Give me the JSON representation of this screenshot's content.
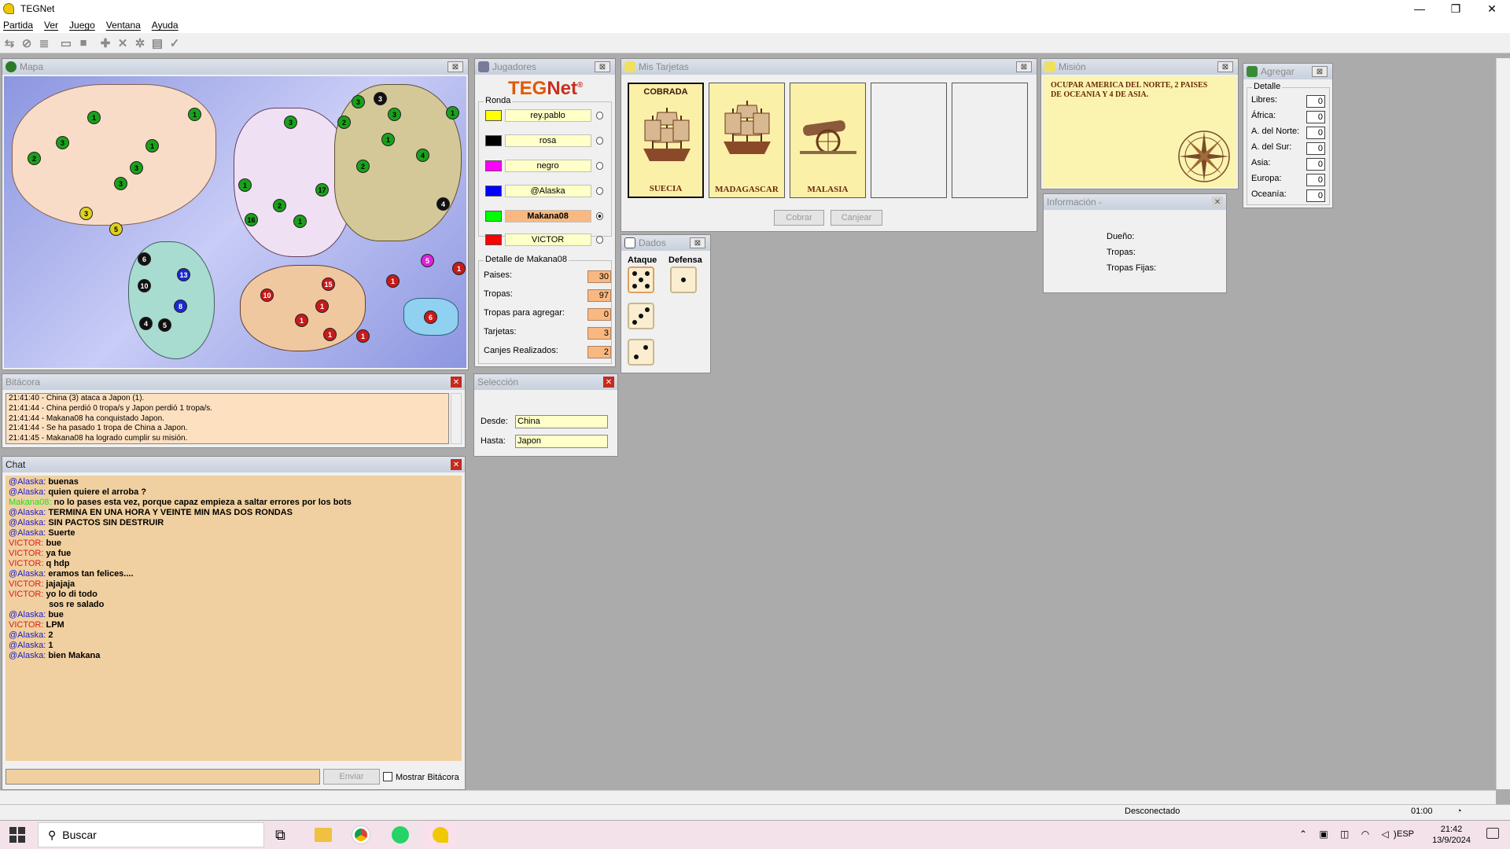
{
  "window": {
    "title": "TEGNet",
    "minimize": "—",
    "maximize": "❐",
    "close": "✕"
  },
  "menu": [
    "Partida",
    "Ver",
    "Juego",
    "Ventana",
    "Ayuda"
  ],
  "map": {
    "title": "Mapa",
    "armies": [
      {
        "n": "1",
        "c": "#1aa01a"
      },
      {
        "n": "3",
        "c": "#1aa01a"
      },
      {
        "n": "2",
        "c": "#1aa01a"
      },
      {
        "n": "1",
        "c": "#1aa01a"
      },
      {
        "n": "3",
        "c": "#1aa01a"
      },
      {
        "n": "3",
        "c": "#1aa01a"
      },
      {
        "n": "3",
        "c": "#e0d020"
      },
      {
        "n": "5",
        "c": "#e0d020"
      },
      {
        "n": "1",
        "c": "#1aa01a"
      },
      {
        "n": "6",
        "c": "#111111"
      },
      {
        "n": "10",
        "c": "#111111"
      },
      {
        "n": "13",
        "c": "#1a2ad0"
      },
      {
        "n": "8",
        "c": "#1a2ad0"
      },
      {
        "n": "4",
        "c": "#111111"
      },
      {
        "n": "5",
        "c": "#111111"
      },
      {
        "n": "3",
        "c": "#1aa01a"
      },
      {
        "n": "3",
        "c": "#111111"
      },
      {
        "n": "3",
        "c": "#1aa01a"
      },
      {
        "n": "2",
        "c": "#1aa01a"
      },
      {
        "n": "1",
        "c": "#1aa01a"
      },
      {
        "n": "3",
        "c": "#1aa01a"
      },
      {
        "n": "2",
        "c": "#1aa01a"
      },
      {
        "n": "4",
        "c": "#1aa01a"
      },
      {
        "n": "1",
        "c": "#1aa01a"
      },
      {
        "n": "4",
        "c": "#111111"
      },
      {
        "n": "1",
        "c": "#1aa01a"
      },
      {
        "n": "10",
        "c": "#c81a1a"
      },
      {
        "n": "15",
        "c": "#c81a1a"
      },
      {
        "n": "1",
        "c": "#c81a1a"
      },
      {
        "n": "1",
        "c": "#c81a1a"
      },
      {
        "n": "1",
        "c": "#c81a1a"
      },
      {
        "n": "1",
        "c": "#c81a1a"
      },
      {
        "n": "1",
        "c": "#c81a1a"
      },
      {
        "n": "5",
        "c": "#e020e0"
      },
      {
        "n": "1",
        "c": "#c81a1a"
      },
      {
        "n": "6",
        "c": "#c81a1a"
      },
      {
        "n": "16",
        "c": "#1aa01a"
      },
      {
        "n": "1",
        "c": "#1aa01a"
      },
      {
        "n": "17",
        "c": "#1aa01a"
      },
      {
        "n": "2",
        "c": "#1aa01a"
      }
    ]
  },
  "jugadores": {
    "title": "Jugadores",
    "logo_teg": "TEG",
    "logo_net": "Net",
    "logo_reg": "®",
    "ronda_label": "Ronda",
    "players": [
      {
        "name": "rey.pablo",
        "color": "#ffff00"
      },
      {
        "name": "rosa",
        "color": "#000000"
      },
      {
        "name": "negro",
        "color": "#ff00ff"
      },
      {
        "name": "@Alaska",
        "color": "#0000ff"
      },
      {
        "name": "Makana08",
        "color": "#00ff00"
      },
      {
        "name": "VICTOR",
        "color": "#ff0000"
      }
    ],
    "detail_label": "Detalle de Makana08",
    "details": [
      {
        "label": "Paises:",
        "value": "30"
      },
      {
        "label": "Tropas:",
        "value": "97"
      },
      {
        "label": "Tropas para agregar:",
        "value": "0"
      },
      {
        "label": "Tarjetas:",
        "value": "3"
      },
      {
        "label": "Canjes Realizados:",
        "value": "2"
      }
    ]
  },
  "tarjetas": {
    "title": "Mis Tarjetas",
    "cards": [
      {
        "name": "SUECIA",
        "top": "COBRADA"
      },
      {
        "name": "MADAGASCAR",
        "top": ""
      },
      {
        "name": "MALASIA",
        "top": ""
      }
    ],
    "cobrar": "Cobrar",
    "canjear": "Canjear"
  },
  "mision": {
    "title": "Misión",
    "text": "OCUPAR AMERICA DEL NORTE, 2 PAISES DE OCEANIA Y 4 DE ASIA."
  },
  "agregar": {
    "title": "Agregar",
    "detail_label": "Detalle",
    "rows": [
      {
        "label": "Libres:",
        "value": "0"
      },
      {
        "label": "África:",
        "value": "0"
      },
      {
        "label": "A. del Norte:",
        "value": "0"
      },
      {
        "label": "A. del Sur:",
        "value": "0"
      },
      {
        "label": "Asia:",
        "value": "0"
      },
      {
        "label": "Europa:",
        "value": "0"
      },
      {
        "label": "Oceanía:",
        "value": "0"
      }
    ]
  },
  "informacion": {
    "title": "Información -",
    "dueno": "Dueño:",
    "tropas": "Tropas:",
    "fijas": "Tropas Fijas:"
  },
  "dados": {
    "title": "Dados",
    "ataque": "Ataque",
    "defensa": "Defensa"
  },
  "bitacora": {
    "title": "Bitácora",
    "lines": [
      "21:41:40 - China (3) ataca a Japon (1).",
      "21:41:44 - China perdió 0 tropa/s y Japon perdió 1 tropa/s.",
      "21:41:44 - Makana08 ha conquistado Japon.",
      "21:41:44 - Se ha pasado 1 tropa de China a Japon.",
      "21:41:45 - Makana08 ha logrado cumplir su misión."
    ]
  },
  "seleccion": {
    "title": "Selección",
    "desde_label": "Desde:",
    "desde": "China",
    "hasta_label": "Hasta:",
    "hasta": "Japon"
  },
  "chat": {
    "title": "Chat",
    "messages": [
      {
        "who": "@Alaska:",
        "msg": "buenas",
        "color": "#1a1ad0"
      },
      {
        "who": "@Alaska:",
        "msg": "quien quiere el arroba ?",
        "color": "#1a1ad0"
      },
      {
        "who": "Makana08:",
        "msg": "no lo pases esta vez, porque capaz empieza a saltar errores por los bots",
        "color": "#20e020"
      },
      {
        "who": "@Alaska:",
        "msg": "TERMINA EN UNA HORA Y VEINTE MIN MAS DOS RONDAS",
        "color": "#1a1ad0"
      },
      {
        "who": "@Alaska:",
        "msg": "SIN PACTOS SIN DESTRUIR",
        "color": "#1a1ad0"
      },
      {
        "who": "@Alaska:",
        "msg": "Suerte",
        "color": "#1a1ad0"
      },
      {
        "who": "VICTOR:",
        "msg": "bue",
        "color": "#e01a1a"
      },
      {
        "who": "VICTOR:",
        "msg": "ya fue",
        "color": "#e01a1a"
      },
      {
        "who": "VICTOR:",
        "msg": "q hdp",
        "color": "#e01a1a"
      },
      {
        "who": "@Alaska:",
        "msg": "eramos tan felices....",
        "color": "#1a1ad0"
      },
      {
        "who": "VICTOR:",
        "msg": "jajajaja",
        "color": "#e01a1a"
      },
      {
        "who": "VICTOR:",
        "msg": "yo lo di todo",
        "color": "#e01a1a"
      },
      {
        "who": "",
        "msg": "sos re salado",
        "color": "#e0e020"
      },
      {
        "who": "@Alaska:",
        "msg": "bue",
        "color": "#1a1ad0"
      },
      {
        "who": "VICTOR:",
        "msg": "LPM",
        "color": "#e01a1a"
      },
      {
        "who": "@Alaska:",
        "msg": "2",
        "color": "#1a1ad0"
      },
      {
        "who": "@Alaska:",
        "msg": "1",
        "color": "#1a1ad0"
      },
      {
        "who": "@Alaska:",
        "msg": "bien Makana",
        "color": "#1a1ad0"
      }
    ],
    "send": "Enviar",
    "show_log": "Mostrar Bitácora"
  },
  "statusbar": {
    "state": "Desconectado",
    "time": "01:00"
  },
  "taskbar": {
    "search": "Buscar",
    "lang": "ESP",
    "clock": "21:42",
    "date": "13/9/2024"
  }
}
